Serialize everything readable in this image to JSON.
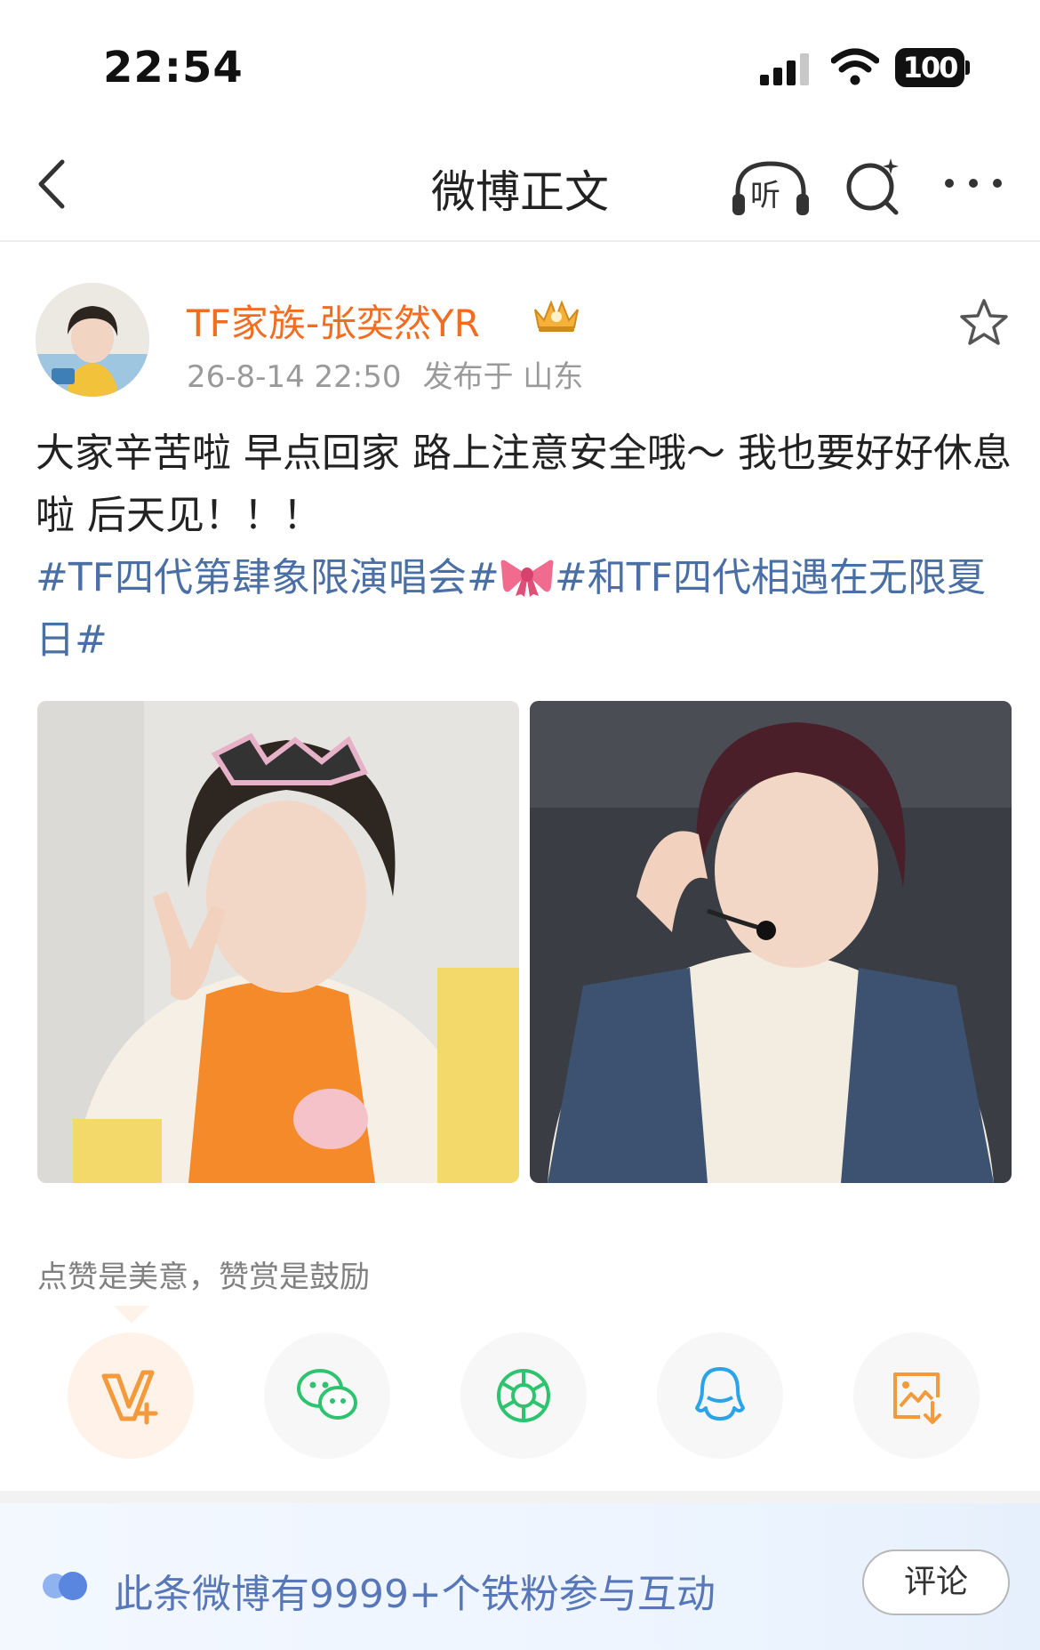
{
  "status_bar": {
    "time": "22:54",
    "battery": "100"
  },
  "nav": {
    "title": "微博正文",
    "listen_label": "听",
    "icons": [
      "back-icon",
      "listen-icon",
      "search-icon",
      "more-icon"
    ]
  },
  "post": {
    "username": "TF家族-张奕然YR",
    "timestamp": "26-8-14 22:50",
    "location": "发布于 山东",
    "text_line": "大家辛苦啦 早点回家 路上注意安全哦～ 我也要好好休息啦 后天见！！！",
    "topic_1": "#TF四代第肆象限演唱会#",
    "topic_2": "#和TF四代相遇在无限夏日#",
    "photos": [
      "photo-1",
      "photo-2"
    ]
  },
  "reward": {
    "text": "点赞是美意，赞赏是鼓励"
  },
  "share": {
    "items": [
      "v-plus-icon",
      "wechat-icon",
      "moments-icon",
      "qq-icon",
      "save-image-icon"
    ]
  },
  "fans": {
    "text": "此条微博有9999+个铁粉参与互动",
    "comment_label": "评论"
  },
  "colors": {
    "username": "#f26d22",
    "topic": "#4a6fa5",
    "fans_text": "#5877b8",
    "wechat": "#2dc36f",
    "qq": "#2aa3e8",
    "accent_orange": "#f39a3c"
  }
}
